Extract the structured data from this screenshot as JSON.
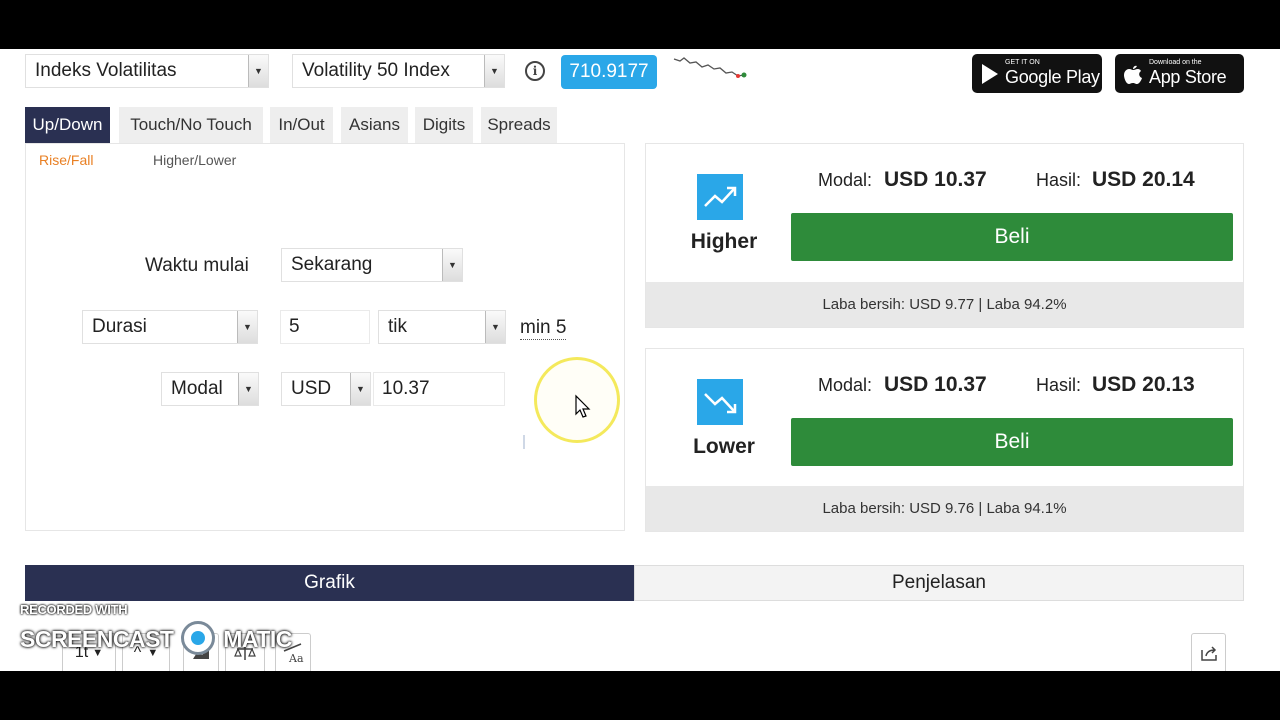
{
  "header": {
    "market_select": "Indeks Volatilitas",
    "submarket_select": "Volatility 50 Index",
    "spot_price": "710.9177",
    "google_play": {
      "small": "GET IT ON",
      "big": "Google Play"
    },
    "app_store": {
      "small": "Download on the",
      "big": "App Store"
    }
  },
  "tabs": [
    {
      "label": "Up/Down",
      "active": true
    },
    {
      "label": "Touch/No Touch",
      "active": false
    },
    {
      "label": "In/Out",
      "active": false
    },
    {
      "label": "Asians",
      "active": false
    },
    {
      "label": "Digits",
      "active": false
    },
    {
      "label": "Spreads",
      "active": false
    }
  ],
  "subtabs": [
    {
      "label": "Rise/Fall",
      "active": true
    },
    {
      "label": "Higher/Lower",
      "active": false
    }
  ],
  "form": {
    "start_label": "Waktu mulai",
    "start_value": "Sekarang",
    "duration_type": "Durasi",
    "duration_value": "5",
    "duration_unit": "tik",
    "duration_min": "min 5",
    "amount_type": "Modal",
    "currency": "USD",
    "amount_value": "10.37"
  },
  "contracts": [
    {
      "kind": "Higher",
      "stake_label": "Modal:",
      "stake_value": "USD 10.37",
      "payout_label": "Hasil:",
      "payout_value": "USD 20.14",
      "buy_label": "Beli",
      "footer": "Laba bersih: USD 9.77 | Laba 94.2%"
    },
    {
      "kind": "Lower",
      "stake_label": "Modal:",
      "stake_value": "USD 10.37",
      "payout_label": "Hasil:",
      "payout_value": "USD 20.13",
      "buy_label": "Beli",
      "footer": "Laba bersih: USD 9.76 | Laba 94.1%"
    }
  ],
  "bottom_tabs": [
    {
      "label": "Grafik",
      "active": true
    },
    {
      "label": "Penjelasan",
      "active": false
    }
  ],
  "chart_toolbar": {
    "interval": "1t",
    "chart_type": "^"
  },
  "watermark": {
    "line1": "RECORDED WITH",
    "line2_a": "SCREENCAST",
    "line2_b": "MATIC"
  },
  "colors": {
    "accent_blue": "#2aa7e8",
    "tab_active": "#2a3052",
    "buy_green": "#2e8b3a",
    "subtab_active": "#e98024"
  }
}
